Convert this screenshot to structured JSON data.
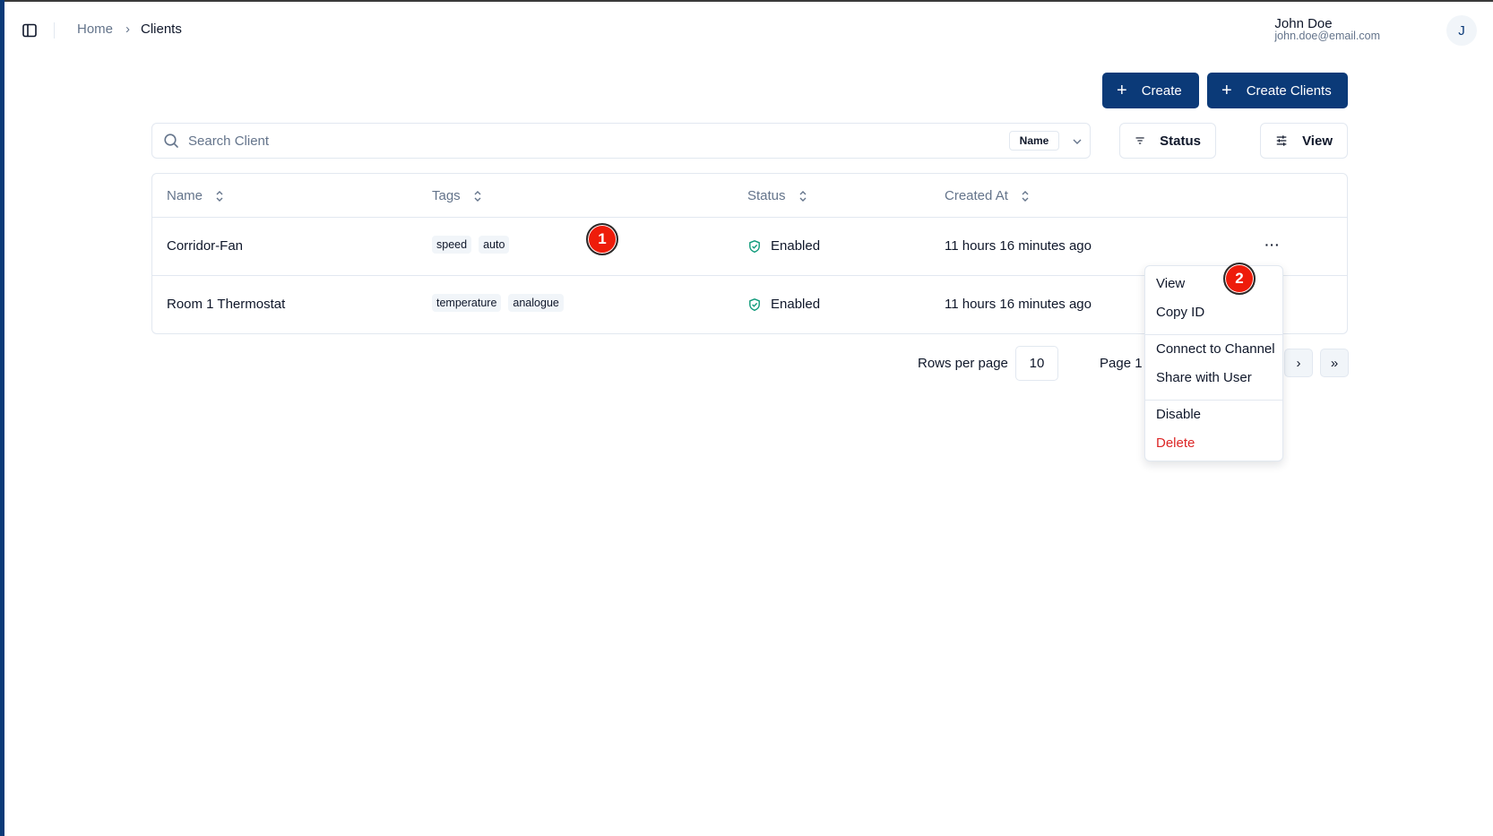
{
  "header": {
    "breadcrumb": {
      "home": "Home",
      "separator": "›",
      "current": "Clients"
    },
    "user": {
      "name": "John Doe",
      "email": "john.doe@email.com",
      "avatar_initial": "J"
    }
  },
  "toolbar": {
    "create_label": "Create",
    "create_clients_label": "Create Clients",
    "search_placeholder": "Search Client",
    "search_value": "",
    "search_field_select": "Name",
    "status_filter_label": "Status",
    "view_label": "View"
  },
  "table": {
    "columns": [
      "Name",
      "Tags",
      "Status",
      "Created At"
    ],
    "rows": [
      {
        "name": "Corridor-Fan",
        "tags": [
          "speed",
          "auto"
        ],
        "status": "Enabled",
        "created_at": "11 hours 16 minutes ago"
      },
      {
        "name": "Room 1 Thermostat",
        "tags": [
          "temperature",
          "analogue"
        ],
        "status": "Enabled",
        "created_at": "11 hours 16 minutes ago"
      }
    ],
    "actions_label": "···"
  },
  "pagination": {
    "rows_per_page_label": "Rows per page",
    "rows_per_page_value": "10",
    "page_label": "Page 1 ",
    "next_label": "›",
    "last_label": "»"
  },
  "context_menu": {
    "items": [
      "View",
      "Copy ID",
      "Connect to Channel",
      "Share with User",
      "Disable",
      "Delete"
    ]
  },
  "annotations": {
    "badge1": "1",
    "badge2": "2"
  },
  "colors": {
    "primary": "#0b3a78",
    "danger": "#dc2626",
    "status_enabled": "#0f9a7a",
    "badge": "#ee1c0a"
  }
}
